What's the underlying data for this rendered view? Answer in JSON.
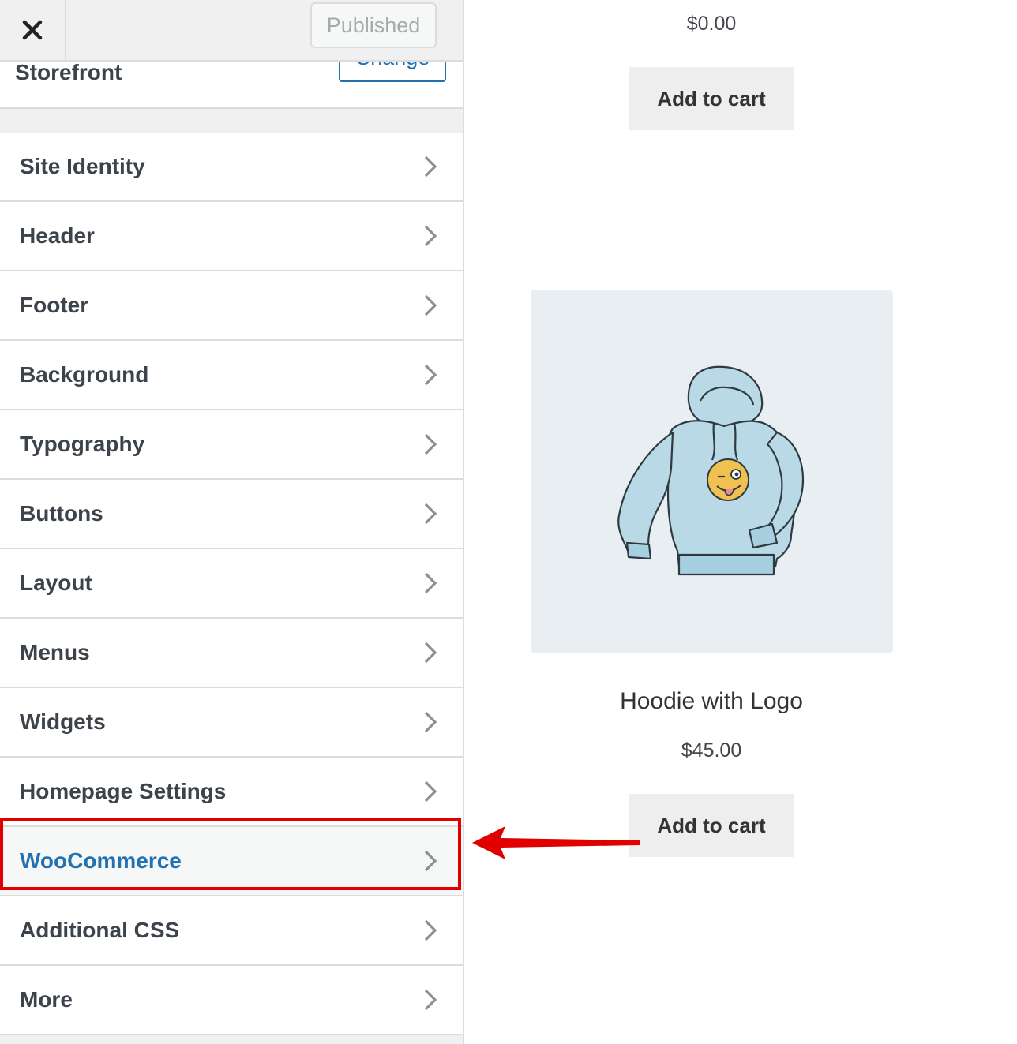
{
  "topbar": {
    "close_icon": "close-icon",
    "publish_label": "Published"
  },
  "theme": {
    "name": "Storefront",
    "change_label": "Change"
  },
  "menu": {
    "items": [
      {
        "label": "Site Identity"
      },
      {
        "label": "Header"
      },
      {
        "label": "Footer"
      },
      {
        "label": "Background"
      },
      {
        "label": "Typography"
      },
      {
        "label": "Buttons"
      },
      {
        "label": "Layout"
      },
      {
        "label": "Menus"
      },
      {
        "label": "Widgets"
      },
      {
        "label": "Homepage Settings"
      },
      {
        "label": "WooCommerce",
        "active": true
      },
      {
        "label": "Additional CSS"
      },
      {
        "label": "More"
      }
    ],
    "chevron_icon": "chevron-right-icon"
  },
  "colors": {
    "accent": "#2271b1",
    "highlight": "#e00000"
  },
  "preview": {
    "product_prev": {
      "price": "$0.00",
      "button_label": "Add to cart"
    },
    "product": {
      "title": "Hoodie with Logo",
      "price": "$45.00",
      "button_label": "Add to cart",
      "image_icon": "hoodie-image"
    }
  }
}
